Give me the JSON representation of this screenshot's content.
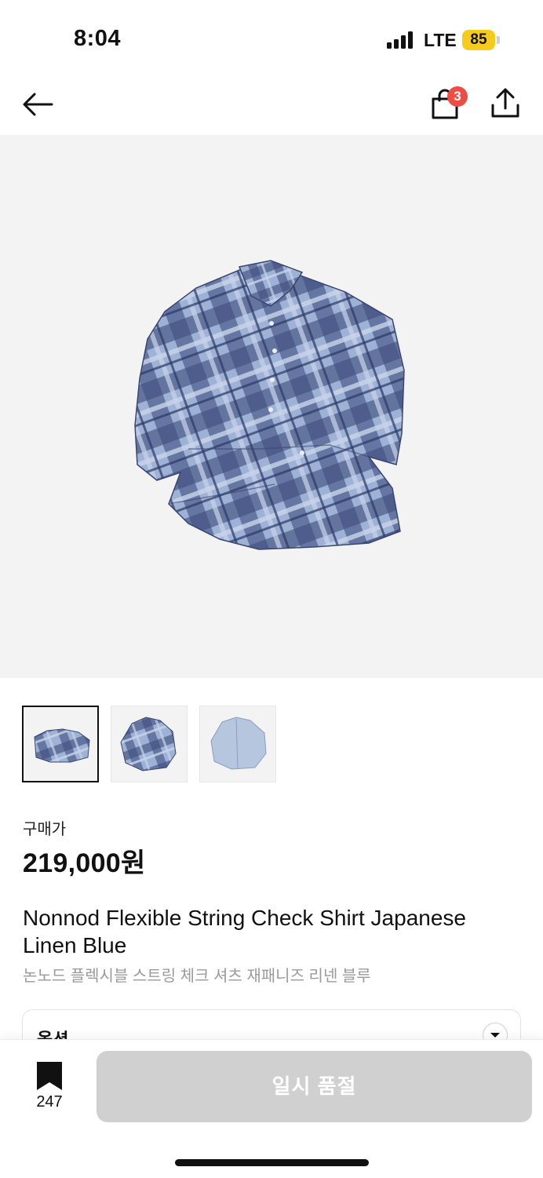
{
  "status_bar": {
    "time": "8:04",
    "network": "LTE",
    "battery": "85"
  },
  "header": {
    "cart_count": "3"
  },
  "product": {
    "price_label": "구매가",
    "price": "219,000원",
    "title_en": "Nonnod Flexible String Check Shirt Japanese Linen Blue",
    "title_ko": "논노드 플렉시블 스트링 체크 셔츠 재패니즈 리넨 블루",
    "thumbnails_count": 3,
    "selected_thumbnail": 1
  },
  "options": {
    "label": "옵션"
  },
  "bottom_bar": {
    "bookmark_count": "247",
    "soldout_label": "일시 품절"
  },
  "colors": {
    "accent_badge": "#ef4c44",
    "battery": "#f5cc1c",
    "disabled_button": "#d0d0d0",
    "image_bg": "#f3f3f3"
  },
  "icons": [
    "back-arrow-icon",
    "shopping-bag-icon",
    "share-icon",
    "bookmark-icon",
    "chevron-down-icon"
  ]
}
